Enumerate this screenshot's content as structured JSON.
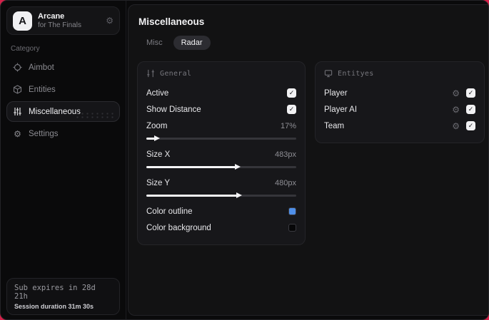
{
  "app": {
    "name": "Arcane",
    "subtitle": "for The Finals",
    "avatar_letter": "A"
  },
  "sidebar": {
    "category_label": "Category",
    "items": [
      {
        "label": "Aimbot",
        "icon": "crosshair-icon",
        "selected": false
      },
      {
        "label": "Entities",
        "icon": "cube-icon",
        "selected": false
      },
      {
        "label": "Miscellaneous",
        "icon": "sliders-icon",
        "selected": true
      },
      {
        "label": "Settings",
        "icon": "gear-icon",
        "selected": false
      }
    ],
    "subscription": {
      "line1": "Sub expires in 28d 21h",
      "line2": "Session duration 31m 30s"
    }
  },
  "main": {
    "title": "Miscellaneous",
    "tabs": [
      {
        "label": "Misc",
        "selected": false
      },
      {
        "label": "Radar",
        "selected": true
      }
    ],
    "general_panel": {
      "title": "General",
      "toggles": [
        {
          "label": "Active",
          "checked": true
        },
        {
          "label": "Show Distance",
          "checked": true
        }
      ],
      "sliders": [
        {
          "label": "Zoom",
          "value": "17%",
          "percent": 6
        },
        {
          "label": "Size X",
          "value": "483px",
          "percent": 60
        },
        {
          "label": "Size Y",
          "value": "480px",
          "percent": 61
        }
      ],
      "colors": [
        {
          "label": "Color outline",
          "color": "#4f8fe8"
        },
        {
          "label": "Color background",
          "color": "#070708"
        }
      ]
    },
    "entities_panel": {
      "title": "Entityes",
      "rows": [
        {
          "label": "Player",
          "checked": true
        },
        {
          "label": "Player AI",
          "checked": true
        },
        {
          "label": "Team",
          "checked": true
        }
      ]
    }
  },
  "colors": {
    "backdrop_accent": "#d42149",
    "outline_swatch": "#4f8fe8",
    "background_swatch": "#070708"
  }
}
